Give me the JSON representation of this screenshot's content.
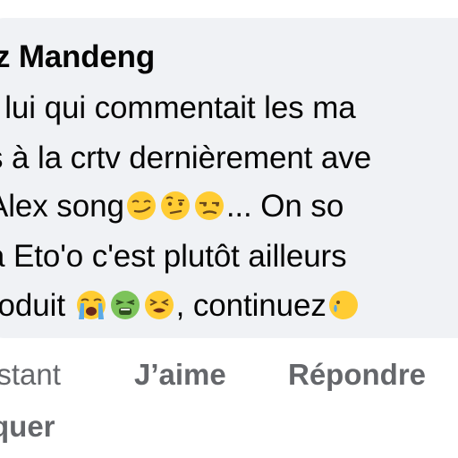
{
  "comment": {
    "author": "z Mandeng",
    "lines": [
      "t lui qui commentait les ma",
      "s à la crtv dernièrement ave",
      "Alex song",
      "... On so",
      "à Eto'o c'est plutôt ailleurs",
      "roduit ",
      ", continuez"
    ],
    "emojis": [
      "smirking-face",
      "face-with-raised-eyebrow",
      "unamused-face",
      "loudly-crying-face",
      "nauseated-face",
      "tired-face",
      "crying-face-partial"
    ]
  },
  "actions": {
    "time": "nstant",
    "like": "J’aime",
    "reply": "Répondre",
    "hide": "quer"
  },
  "colors": {
    "bubble": "#f0f2f5",
    "text": "#050505",
    "action_text": "#65676b",
    "emoji_yellow": "#ffcc33",
    "emoji_green": "#7cc35a",
    "tear_blue": "#5aa9e6"
  }
}
